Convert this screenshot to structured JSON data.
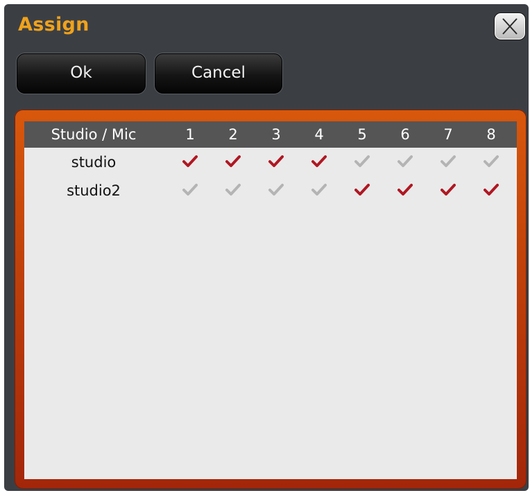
{
  "dialog": {
    "title": "Assign",
    "close_icon": "close-x-icon"
  },
  "buttons": {
    "ok_label": "Ok",
    "cancel_label": "Cancel"
  },
  "table": {
    "corner_header": "Studio / Mic",
    "mic_headers": [
      "1",
      "2",
      "3",
      "4",
      "5",
      "6",
      "7",
      "8"
    ],
    "rows": [
      {
        "studio": "studio",
        "assigned": [
          true,
          true,
          true,
          true,
          false,
          false,
          false,
          false
        ]
      },
      {
        "studio": "studio2",
        "assigned": [
          false,
          false,
          false,
          false,
          true,
          true,
          true,
          true
        ]
      }
    ]
  },
  "colors": {
    "title": "#f0a21c",
    "check_on": "#b01722",
    "check_off": "#b4b4b4",
    "panel_frame": "#c1420a",
    "header_bg": "#555555"
  }
}
